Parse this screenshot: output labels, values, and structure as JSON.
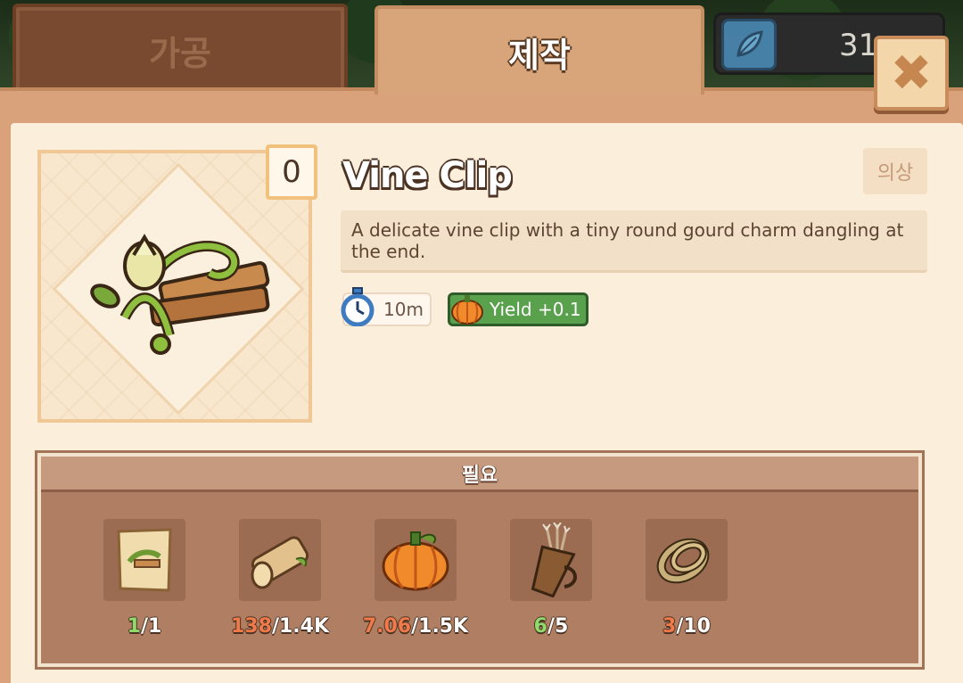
{
  "tabs": [
    {
      "label": "가공",
      "active": false
    },
    {
      "label": "제작",
      "active": true
    }
  ],
  "currency": {
    "value": "31",
    "icon": "leaf-gem-icon"
  },
  "close_icon": "close-x-icon",
  "item": {
    "owned_count": "0",
    "title": "Vine Clip",
    "category_tag": "의상",
    "description": "A delicate vine clip with a tiny round gourd charm dangling at the end.",
    "craft_time": "10m",
    "yield_label": "Yield +0.1"
  },
  "requirements": {
    "header": "필요",
    "items": [
      {
        "icon": "vine-clip-recipe-scroll-icon",
        "have": "1",
        "need": "/1",
        "sufficient": true
      },
      {
        "icon": "wood-log-icon",
        "have": "138",
        "need": "/1.4K",
        "sufficient": false
      },
      {
        "icon": "pumpkin-icon",
        "have": "7.06",
        "need": "/1.5K",
        "sufficient": false
      },
      {
        "icon": "arrow-quiver-icon",
        "have": "6",
        "need": "/5",
        "sufficient": true
      },
      {
        "icon": "rope-coil-icon",
        "have": "3",
        "need": "/10",
        "sufficient": false
      }
    ]
  },
  "colors": {
    "panel_bg": "#fbeedb",
    "frame": "#d9a27a",
    "yield_green": "#5aa14e",
    "have_ok": "#8fdc6c",
    "have_low": "#f07a4a"
  }
}
